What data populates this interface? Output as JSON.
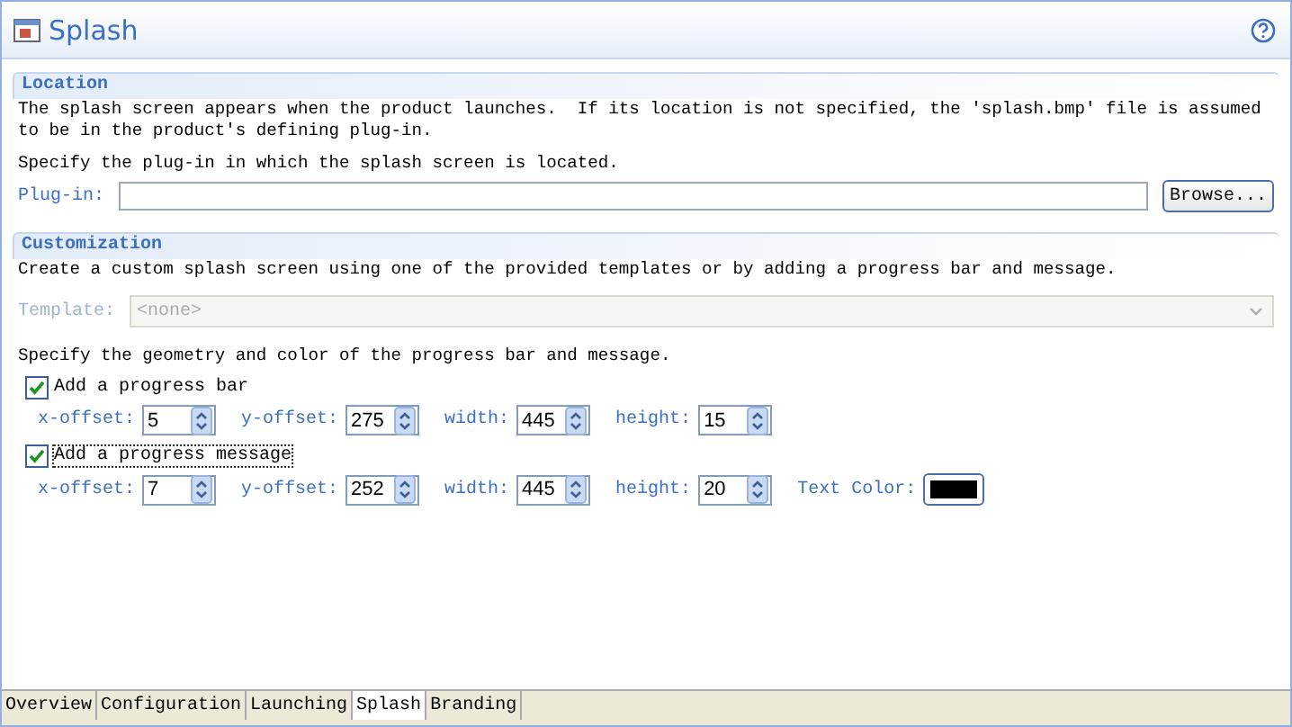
{
  "header": {
    "title": "Splash"
  },
  "location": {
    "title": "Location",
    "description": "The splash screen appears when the product launches.  If its location is not specified, the 'splash.bmp' file is assumed to be in the product's defining plug-in.",
    "instruction": "Specify the plug-in in which the splash screen is located.",
    "plugin_label": "Plug-in:",
    "browse_button": "Browse..."
  },
  "customization": {
    "title": "Customization",
    "description": "Create a custom splash screen using one of the provided templates or by adding a progress bar and message.",
    "template_label": "Template:",
    "template_value": "<none>",
    "instruction": "Specify the geometry and color of the progress bar and message.",
    "groups": [
      {
        "kind": "bar",
        "label": "Add a progress bar",
        "checked": true,
        "focused": false,
        "fields": [
          {
            "label": "x-offset:",
            "value": "5"
          },
          {
            "label": "y-offset:",
            "value": "275"
          },
          {
            "label": "width:",
            "value": "445"
          },
          {
            "label": "height:",
            "value": "15"
          }
        ]
      },
      {
        "kind": "message",
        "label": "Add a progress message",
        "checked": true,
        "focused": true,
        "fields": [
          {
            "label": "x-offset:",
            "value": "7"
          },
          {
            "label": "y-offset:",
            "value": "252"
          },
          {
            "label": "width:",
            "value": "445"
          },
          {
            "label": "height:",
            "value": "20"
          }
        ],
        "text_color_label": "Text Color:",
        "color": "#000000"
      }
    ]
  },
  "tabs": [
    {
      "label": "Overview",
      "selected": false
    },
    {
      "label": "Configuration",
      "selected": false
    },
    {
      "label": "Launching",
      "selected": false
    },
    {
      "label": "Splash",
      "selected": true
    },
    {
      "label": "Branding",
      "selected": false
    }
  ]
}
